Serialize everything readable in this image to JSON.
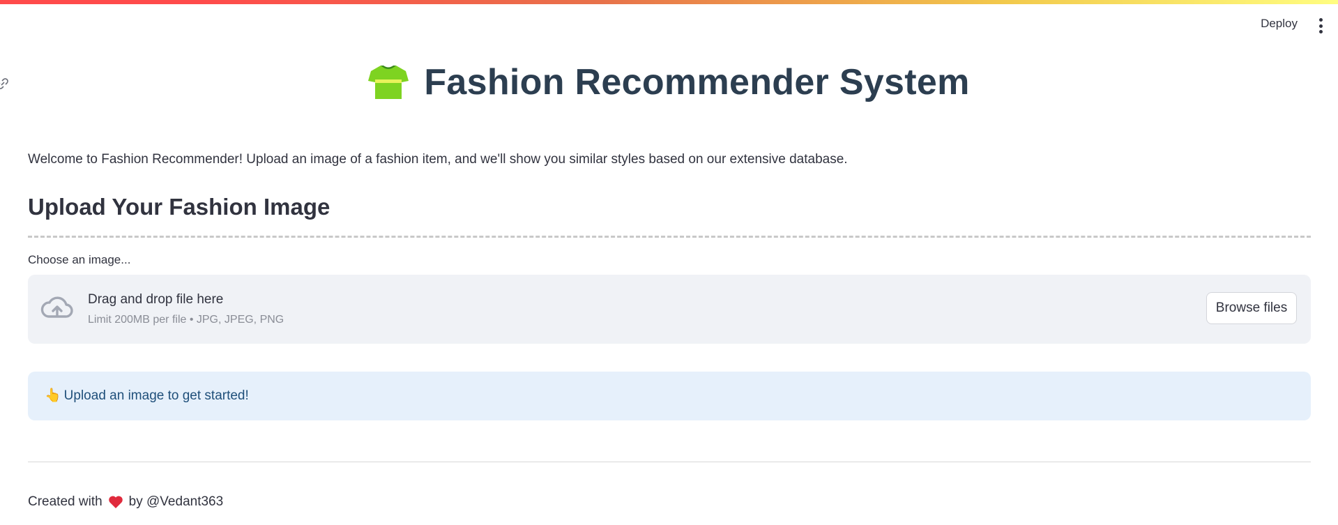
{
  "header": {
    "deploy_label": "Deploy",
    "menu_icon": "kebab-menu-icon"
  },
  "title": {
    "icon": "tshirt-icon",
    "text": "Fashion Recommender System"
  },
  "welcome_text": "Welcome to Fashion Recommender! Upload an image of a fashion item, and we'll show you similar styles based on our extensive database.",
  "upload_section": {
    "heading": "Upload Your Fashion Image",
    "field_label": "Choose an image...",
    "dropzone_title": "Drag and drop file here",
    "dropzone_limit": "Limit 200MB per file • JPG, JPEG, PNG",
    "browse_label": "Browse files"
  },
  "info": {
    "emoji": "👆",
    "text": "Upload an image to get started!"
  },
  "footer": {
    "prefix": "Created with",
    "suffix": "by @Vedant363"
  },
  "colors": {
    "title": "#2c3e50",
    "info_bg": "#e6f0fb",
    "info_text": "#1f4f7a",
    "dropzone_bg": "#f0f2f6"
  }
}
